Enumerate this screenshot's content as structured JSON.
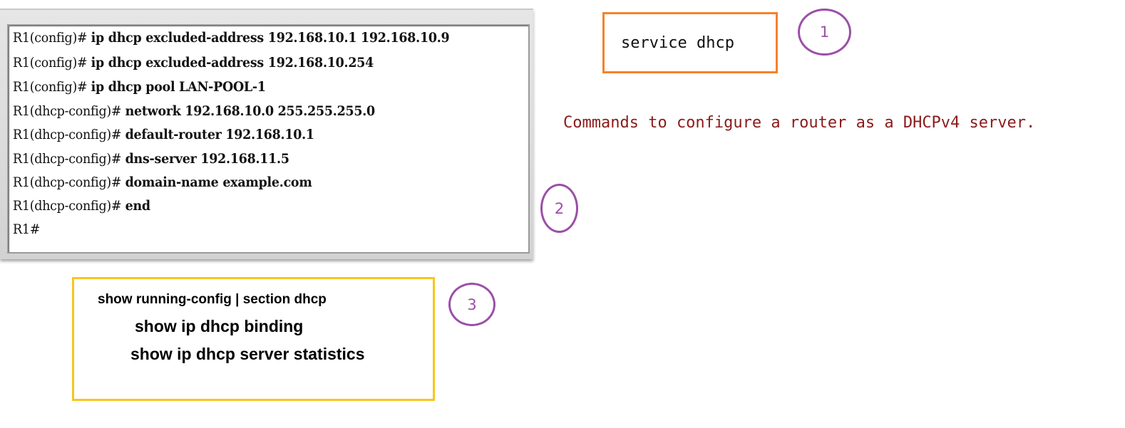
{
  "cli": {
    "lines": [
      {
        "prompt": "R1(config)#",
        "cmd": "ip dhcp excluded-address 192.168.10.1 192.168.10.9"
      },
      {
        "prompt": "R1(config)#",
        "cmd": "ip dhcp excluded-address 192.168.10.254"
      },
      {
        "prompt": "R1(config)#",
        "cmd": "ip dhcp pool LAN-POOL-1"
      },
      {
        "prompt": "R1(dhcp-config)#",
        "cmd": "network 192.168.10.0 255.255.255.0"
      },
      {
        "prompt": "R1(dhcp-config)#",
        "cmd": "default-router 192.168.10.1"
      },
      {
        "prompt": "R1(dhcp-config)#",
        "cmd": "dns-server 192.168.11.5"
      },
      {
        "prompt": "R1(dhcp-config)#",
        "cmd": "domain-name example.com"
      },
      {
        "prompt": "R1(dhcp-config)#",
        "cmd": "end"
      },
      {
        "prompt": "R1#",
        "cmd": ""
      }
    ]
  },
  "service_box": {
    "text": "service dhcp",
    "border_color": "#f5822a"
  },
  "caption": {
    "text": "Commands to configure a router as a DHCPv4 server.",
    "color": "#8b1a1a"
  },
  "markers": {
    "one": "1",
    "two": "2",
    "three": "3",
    "color": "#9b4fa8"
  },
  "show_box": {
    "line1": "show running-config | section dhcp",
    "line2": "show ip dhcp binding",
    "line3": "show ip dhcp server statistics",
    "border_color": "#f7c61d"
  }
}
